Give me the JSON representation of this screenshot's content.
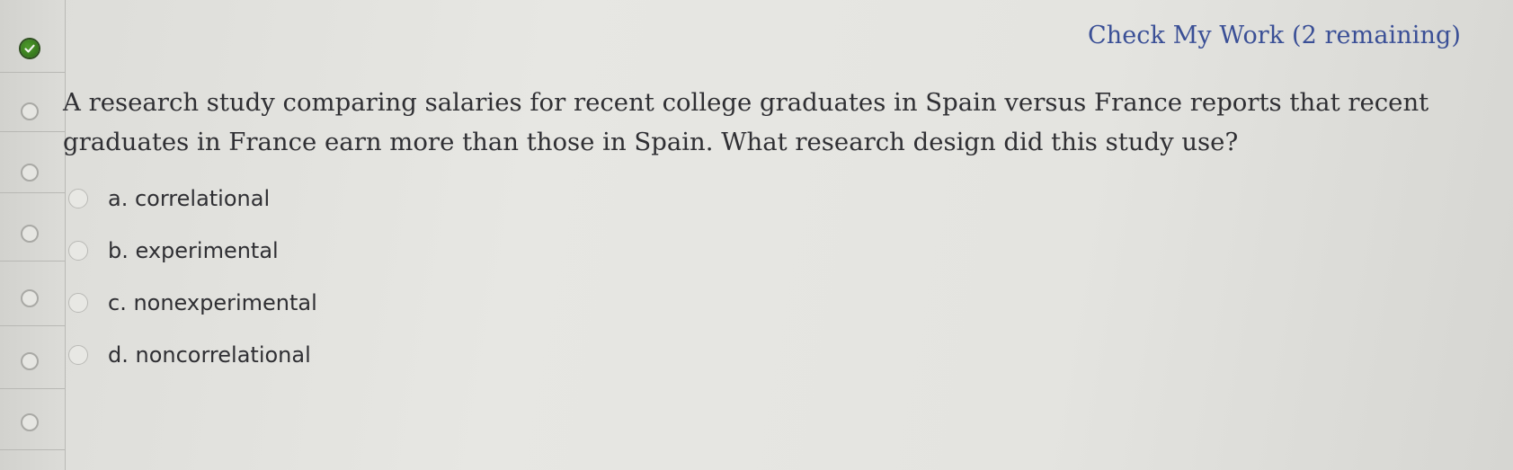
{
  "header": {
    "check_label": "Check My Work (2 remaining)"
  },
  "rail": {
    "nodes": [
      {
        "state": "completed",
        "icon": "check-icon"
      },
      {
        "state": "unanswered"
      },
      {
        "state": "unanswered"
      },
      {
        "state": "unanswered"
      },
      {
        "state": "unanswered"
      },
      {
        "state": "unanswered"
      },
      {
        "state": "unanswered"
      }
    ]
  },
  "question": {
    "text": "A research study comparing salaries for recent college graduates in Spain versus France reports that recent graduates in France earn more than those in Spain. What research design did this study use?"
  },
  "options": [
    {
      "label": "a. correlational",
      "selected": false
    },
    {
      "label": "b. experimental",
      "selected": false
    },
    {
      "label": "c. nonexperimental",
      "selected": false
    },
    {
      "label": "d. noncorrelational",
      "selected": false
    }
  ],
  "colors": {
    "link": "#3a4f96",
    "completed": "#3f8a22"
  }
}
